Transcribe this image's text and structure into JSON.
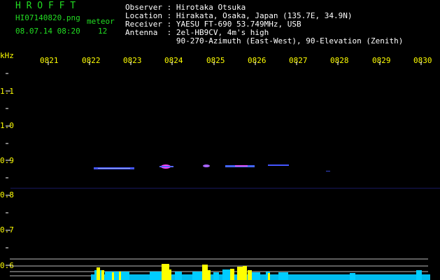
{
  "header": {
    "logo": "H R O F F T",
    "filename": "HI07140820.png",
    "datetime": "08.07.14 08:20",
    "meteor_label": "meteor",
    "meteor_count": "12"
  },
  "info": {
    "observer": "Observer : Hirotaka Otsuka",
    "location": "Location : Hirakata, Osaka, Japan (135.7E, 34.9N)",
    "receiver": "Receiver : YAESU FT-690 53.749MHz, USB",
    "antenna": "Antenna  : 2el-HB9CV, 4m's high",
    "antenna2": "           90-270-Azimuth (East-West), 90-Elevation (Zenith)"
  },
  "axis": {
    "unit": "kHz",
    "times": [
      "0821",
      "0822",
      "0823",
      "0824",
      "0825",
      "0826",
      "0827",
      "0828",
      "0829",
      "0830"
    ],
    "freq_labels": [
      "1.1",
      "1.0",
      "0.9",
      "0.8",
      "0.7",
      "0.6"
    ]
  },
  "colors": {
    "text_green": "#22dd22",
    "text_yellow": "#ffff00",
    "echo_blue": "#3344ff",
    "echo_magenta": "#ff44ff",
    "bar_cyan": "#00ccff",
    "bar_yellow": "#ffff00"
  }
}
